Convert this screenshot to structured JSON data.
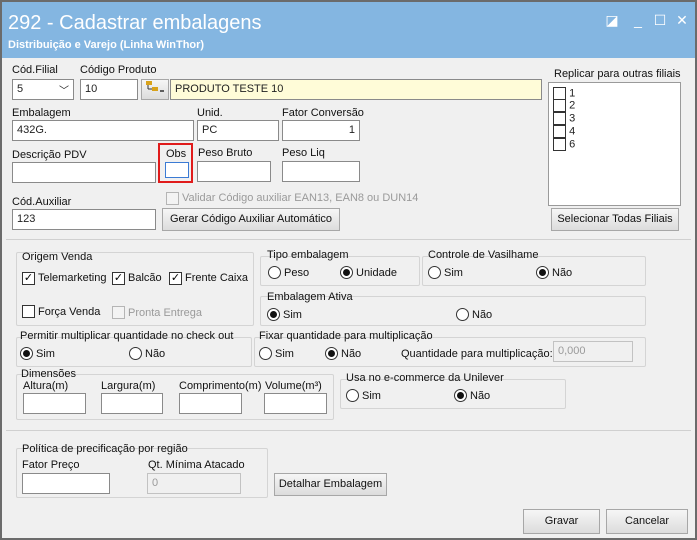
{
  "window": {
    "title": "292 - Cadastrar embalagens",
    "subtitle": "Distribuição e Varejo (Linha WinThor)",
    "controls": {
      "edit": "◪",
      "minimize": "_",
      "maximize": "☐",
      "close": "✕"
    }
  },
  "form": {
    "cod_filial": {
      "label": "Cód.Filial",
      "value": "5"
    },
    "codigo_produto": {
      "label": "Código Produto",
      "value": "10",
      "description": "PRODUTO TESTE 10"
    },
    "embalagem": {
      "label": "Embalagem",
      "value": "432G."
    },
    "unid": {
      "label": "Unid.",
      "value": "PC"
    },
    "fator_conversao": {
      "label": "Fator Conversão",
      "value": "1"
    },
    "descricao_pdv": {
      "label": "Descrição PDV",
      "value": ""
    },
    "obs": {
      "label": "Obs",
      "value": ""
    },
    "peso_bruto": {
      "label": "Peso Bruto",
      "value": ""
    },
    "peso_liq": {
      "label": "Peso Liq",
      "value": ""
    },
    "cod_auxiliar": {
      "label": "Cód.Auxiliar",
      "value": "123"
    },
    "validar_ean": {
      "label": "Validar Código auxiliar EAN13, EAN8 ou DUN14",
      "checked": false
    },
    "gerar_button": "Gerar Código Auxiliar Automático"
  },
  "replicar": {
    "label": "Replicar para outras filiais",
    "items": [
      "1",
      "2",
      "3",
      "4",
      "6"
    ],
    "select_all_button": "Selecionar Todas Filiais"
  },
  "origem_venda": {
    "label": "Origem Venda",
    "telemarketing": {
      "label": "Telemarketing",
      "checked": true
    },
    "balcao": {
      "label": "Balcão",
      "checked": true
    },
    "frente_caixa": {
      "label": "Frente Caixa",
      "checked": true
    },
    "forca_venda": {
      "label": "Força Venda",
      "checked": false
    },
    "pronta_entrega": {
      "label": "Pronta Entrega",
      "checked": false
    }
  },
  "tipo_embalagem": {
    "label": "Tipo embalagem",
    "options": [
      "Peso",
      "Unidade"
    ],
    "selected": "Unidade"
  },
  "controle_vasilhame": {
    "label": "Controle de Vasilhame",
    "options": [
      "Sim",
      "Não"
    ],
    "selected": "Não"
  },
  "embalagem_ativa": {
    "label": "Embalagem Ativa",
    "options": [
      "Sim",
      "Não"
    ],
    "selected": "Sim"
  },
  "permitir_multiplicar": {
    "label": "Permitir multiplicar quantidade no check out",
    "options": [
      "Sim",
      "Não"
    ],
    "selected": "Sim"
  },
  "fixar_quantidade": {
    "label": "Fixar quantidade para multiplicação",
    "options": [
      "Sim",
      "Não"
    ],
    "selected": "Não",
    "qtd_label": "Quantidade para multiplicação:",
    "qtd_value": "0,000"
  },
  "dimensoes": {
    "label": "Dimensões",
    "altura": "Altura(m)",
    "largura": "Largura(m)",
    "comprimento": "Comprimento(m)",
    "volume": "Volume(m³)"
  },
  "ecommerce": {
    "label": "Usa no e-commerce da Unilever",
    "options": [
      "Sim",
      "Não"
    ],
    "selected": "Não"
  },
  "politica": {
    "label": "Política de precificação por região",
    "fator_preco": {
      "label": "Fator Preço",
      "value": ""
    },
    "qt_minima": {
      "label": "Qt. Mínima Atacado",
      "value": "0"
    }
  },
  "detalhar_button": "Detalhar Embalagem",
  "gravar_button": "Gravar",
  "cancelar_button": "Cancelar",
  "colors": {
    "titlebar": "#84b6e1",
    "highlight": "#e01b1b",
    "yellow_field": "#fffcd8"
  }
}
